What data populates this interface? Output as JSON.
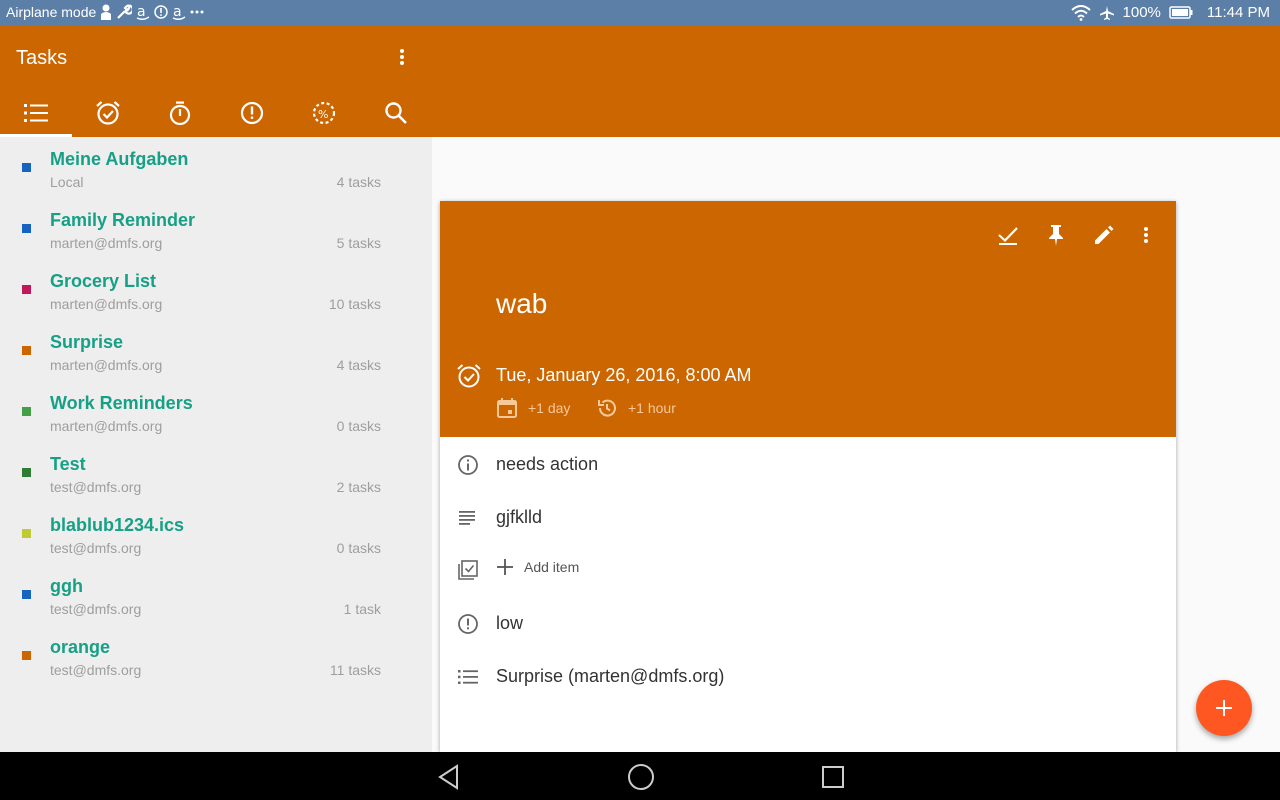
{
  "status_bar": {
    "airplane_label": "Airplane mode",
    "battery": "100%",
    "time": "11:44 PM",
    "icons": [
      "person-icon",
      "wrench-icon",
      "amazon-icon",
      "alert-icon",
      "amazon-icon",
      "more-dots-icon",
      "wifi-icon",
      "airplane-icon",
      "battery-icon"
    ]
  },
  "app_bar": {
    "title": "Tasks",
    "tabs": [
      {
        "icon": "list-icon",
        "active": true
      },
      {
        "icon": "alarm-icon",
        "active": false
      },
      {
        "icon": "timer-icon",
        "active": false
      },
      {
        "icon": "priority-icon",
        "active": false
      },
      {
        "icon": "progress-icon",
        "active": false
      },
      {
        "icon": "search-icon",
        "active": false
      }
    ]
  },
  "lists": [
    {
      "name": "Meine Aufgaben",
      "account": "Local",
      "count": "4 tasks",
      "color": "#1565c0"
    },
    {
      "name": "Family Reminder",
      "account": "marten@dmfs.org",
      "count": "5 tasks",
      "color": "#1565c0"
    },
    {
      "name": "Grocery List",
      "account": "marten@dmfs.org",
      "count": "10 tasks",
      "color": "#c2185b"
    },
    {
      "name": "Surprise",
      "account": "marten@dmfs.org",
      "count": "4 tasks",
      "color": "#cc6600"
    },
    {
      "name": "Work Reminders",
      "account": "marten@dmfs.org",
      "count": "0 tasks",
      "color": "#43a047"
    },
    {
      "name": "Test",
      "account": "test@dmfs.org",
      "count": "2 tasks",
      "color": "#2e7d32"
    },
    {
      "name": "blablub1234.ics",
      "account": "test@dmfs.org",
      "count": "0 tasks",
      "color": "#c0ca33"
    },
    {
      "name": "ggh",
      "account": "test@dmfs.org",
      "count": "1 task",
      "color": "#1565c0"
    },
    {
      "name": "orange",
      "account": "test@dmfs.org",
      "count": "11 tasks",
      "color": "#cc6600"
    }
  ],
  "detail": {
    "title": "wab",
    "due": "Tue, January 26, 2016, 8:00 AM",
    "plus_day": "+1 day",
    "plus_hour": "+1 hour",
    "status": "needs action",
    "description": "gjfklld",
    "add_item": "Add item",
    "priority": "low",
    "list": "Surprise (marten@dmfs.org)"
  },
  "colors": {
    "accent": "#cc6600",
    "fab": "#ff5722",
    "list_name": "#16a085"
  }
}
